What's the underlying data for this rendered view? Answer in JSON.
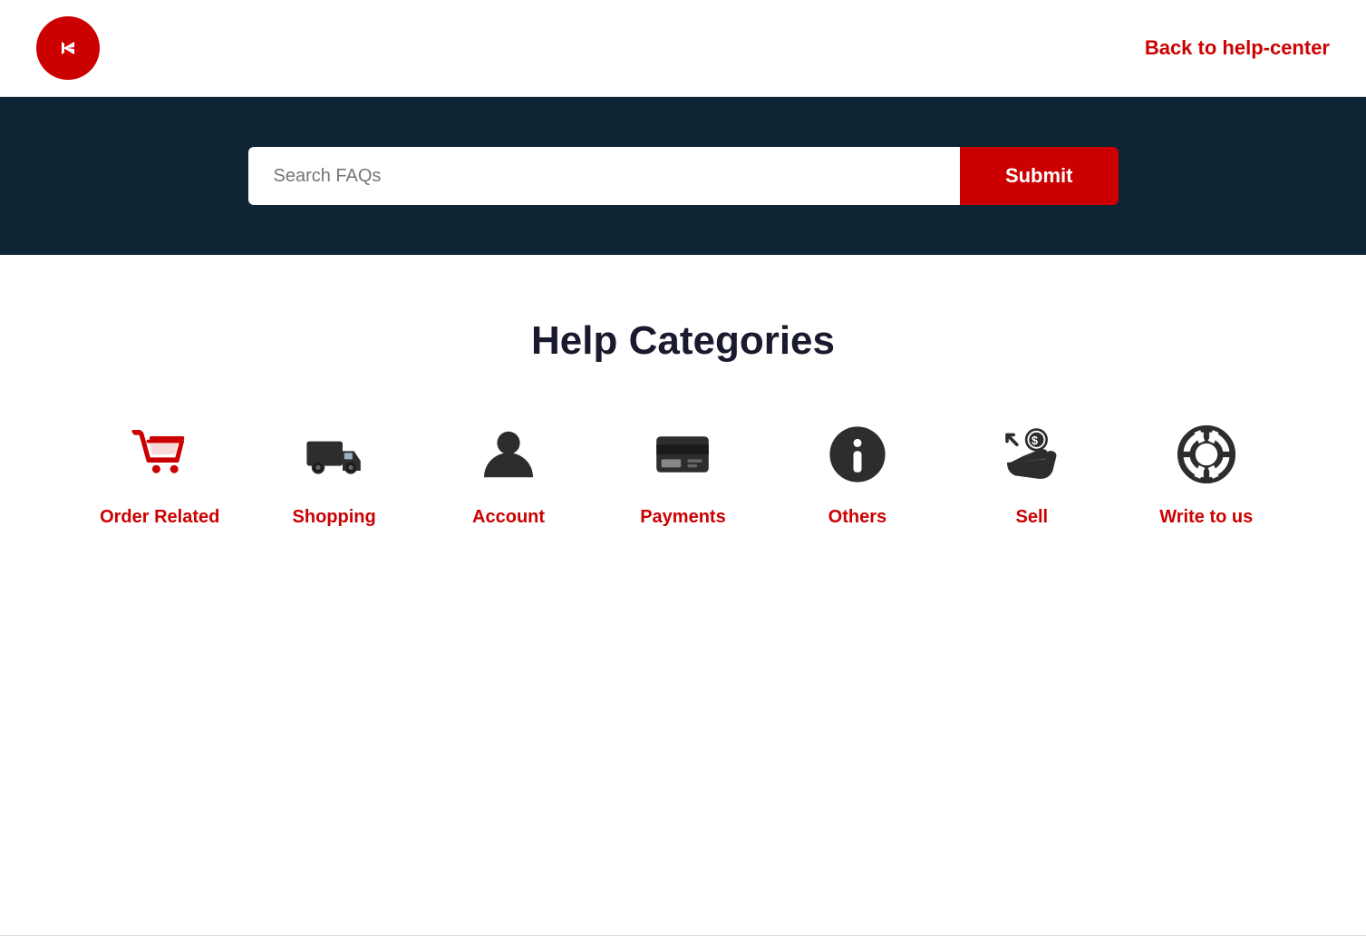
{
  "header": {
    "back_link": "Back to help-center"
  },
  "search": {
    "placeholder": "Search FAQs",
    "submit_label": "Submit"
  },
  "categories": {
    "title": "Help Categories",
    "items": [
      {
        "id": "order-related",
        "label": "Order Related",
        "icon": "cart"
      },
      {
        "id": "shopping",
        "label": "Shopping",
        "icon": "truck"
      },
      {
        "id": "account",
        "label": "Account",
        "icon": "person"
      },
      {
        "id": "payments",
        "label": "Payments",
        "icon": "card"
      },
      {
        "id": "others",
        "label": "Others",
        "icon": "info"
      },
      {
        "id": "sell",
        "label": "Sell",
        "icon": "sell"
      },
      {
        "id": "write-to-us",
        "label": "Write to us",
        "icon": "lifesaver"
      }
    ]
  },
  "colors": {
    "accent": "#cc0000",
    "dark_bg": "#0d2535",
    "icon_dark": "#2d2d2d"
  }
}
